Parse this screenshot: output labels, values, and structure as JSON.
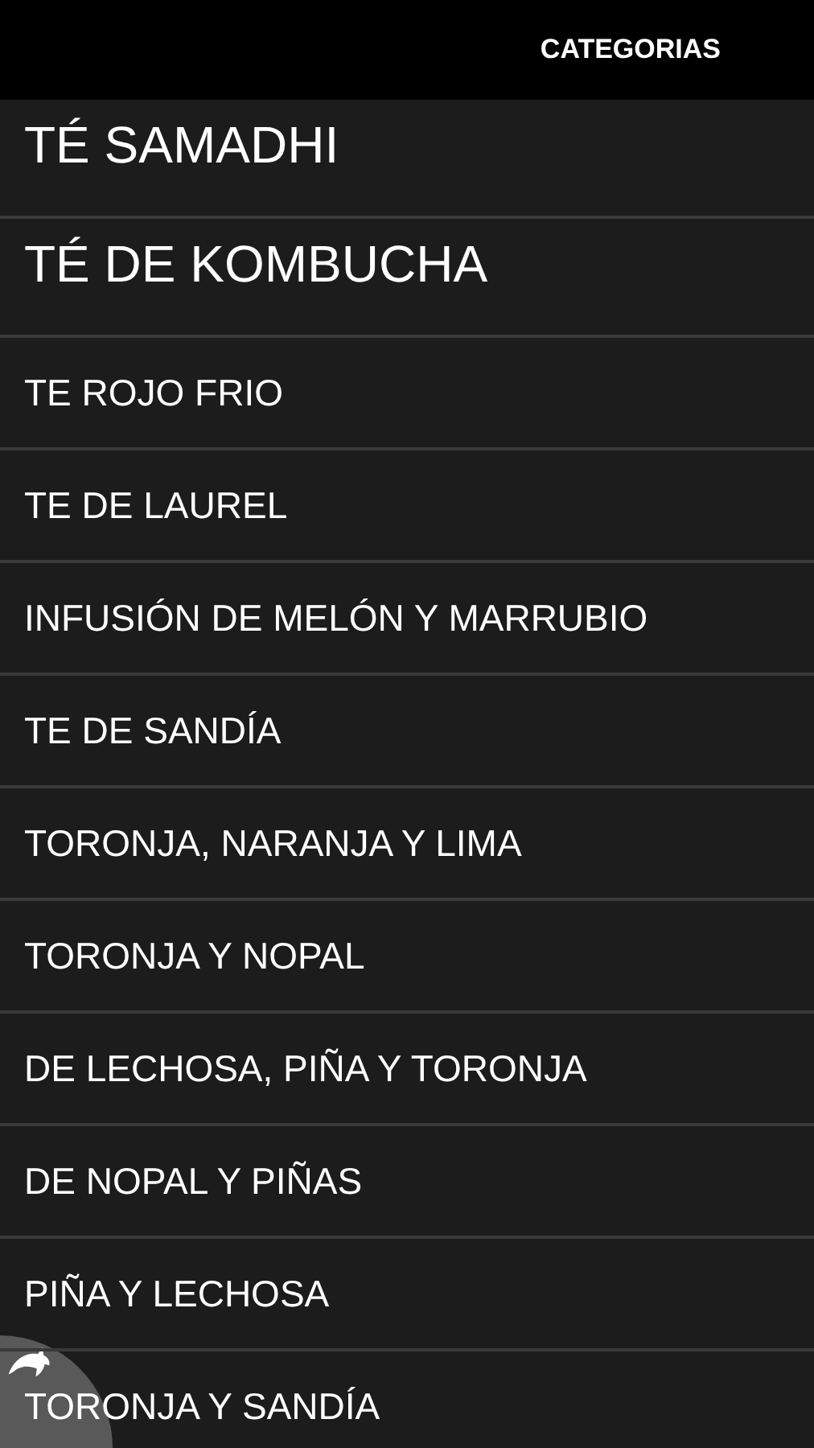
{
  "header": {
    "title": "CATEGORIAS"
  },
  "items": [
    {
      "label": "TÉ SAMADHI",
      "kind": "large"
    },
    {
      "label": "TÉ DE KOMBUCHA",
      "kind": "large"
    },
    {
      "label": "TE ROJO FRIO",
      "kind": "normal"
    },
    {
      "label": "TE DE LAUREL",
      "kind": "normal"
    },
    {
      "label": "INFUSIÓN DE MELÓN Y MARRUBIO",
      "kind": "normal"
    },
    {
      "label": "TE DE SANDÍA",
      "kind": "normal"
    },
    {
      "label": "TORONJA, NARANJA Y LIMA",
      "kind": "normal"
    },
    {
      "label": "TORONJA Y NOPAL",
      "kind": "normal"
    },
    {
      "label": "DE LECHOSA, PIÑA Y TORONJA",
      "kind": "normal"
    },
    {
      "label": "DE NOPAL Y PIÑAS",
      "kind": "normal"
    },
    {
      "label": "PIÑA Y LECHOSA",
      "kind": "normal"
    },
    {
      "label": "TORONJA Y SANDÍA",
      "kind": "normal"
    }
  ]
}
